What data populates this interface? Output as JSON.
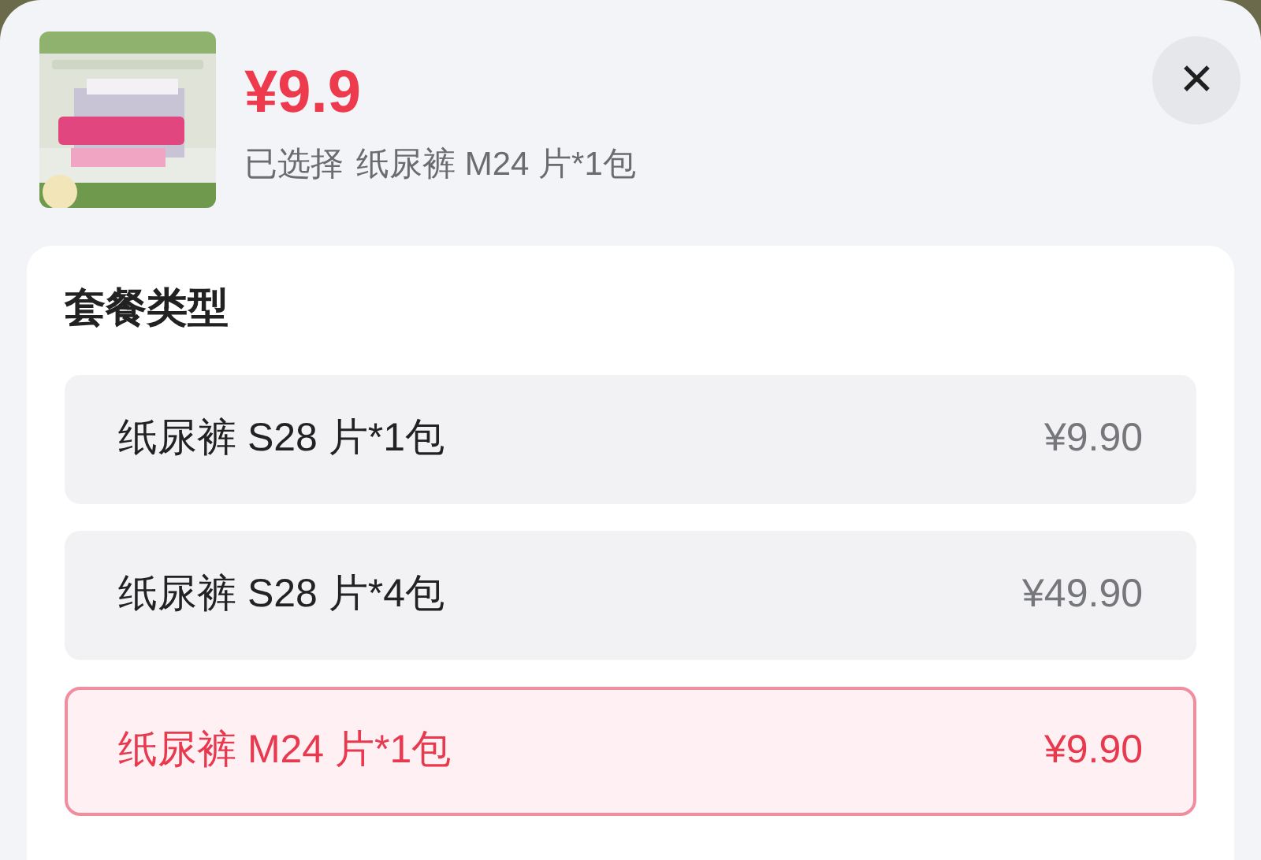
{
  "product": {
    "price": "¥9.9",
    "selected_label": "已选择",
    "selected_value": "纸尿裤 M24 片*1包"
  },
  "close": {
    "label": "✕"
  },
  "package": {
    "title": "套餐类型",
    "options": [
      {
        "name": "纸尿裤 S28 片*1包",
        "price": "¥9.90",
        "selected": false
      },
      {
        "name": "纸尿裤 S28 片*4包",
        "price": "¥49.90",
        "selected": false
      },
      {
        "name": "纸尿裤 M24 片*1包",
        "price": "¥9.90",
        "selected": true
      }
    ]
  }
}
